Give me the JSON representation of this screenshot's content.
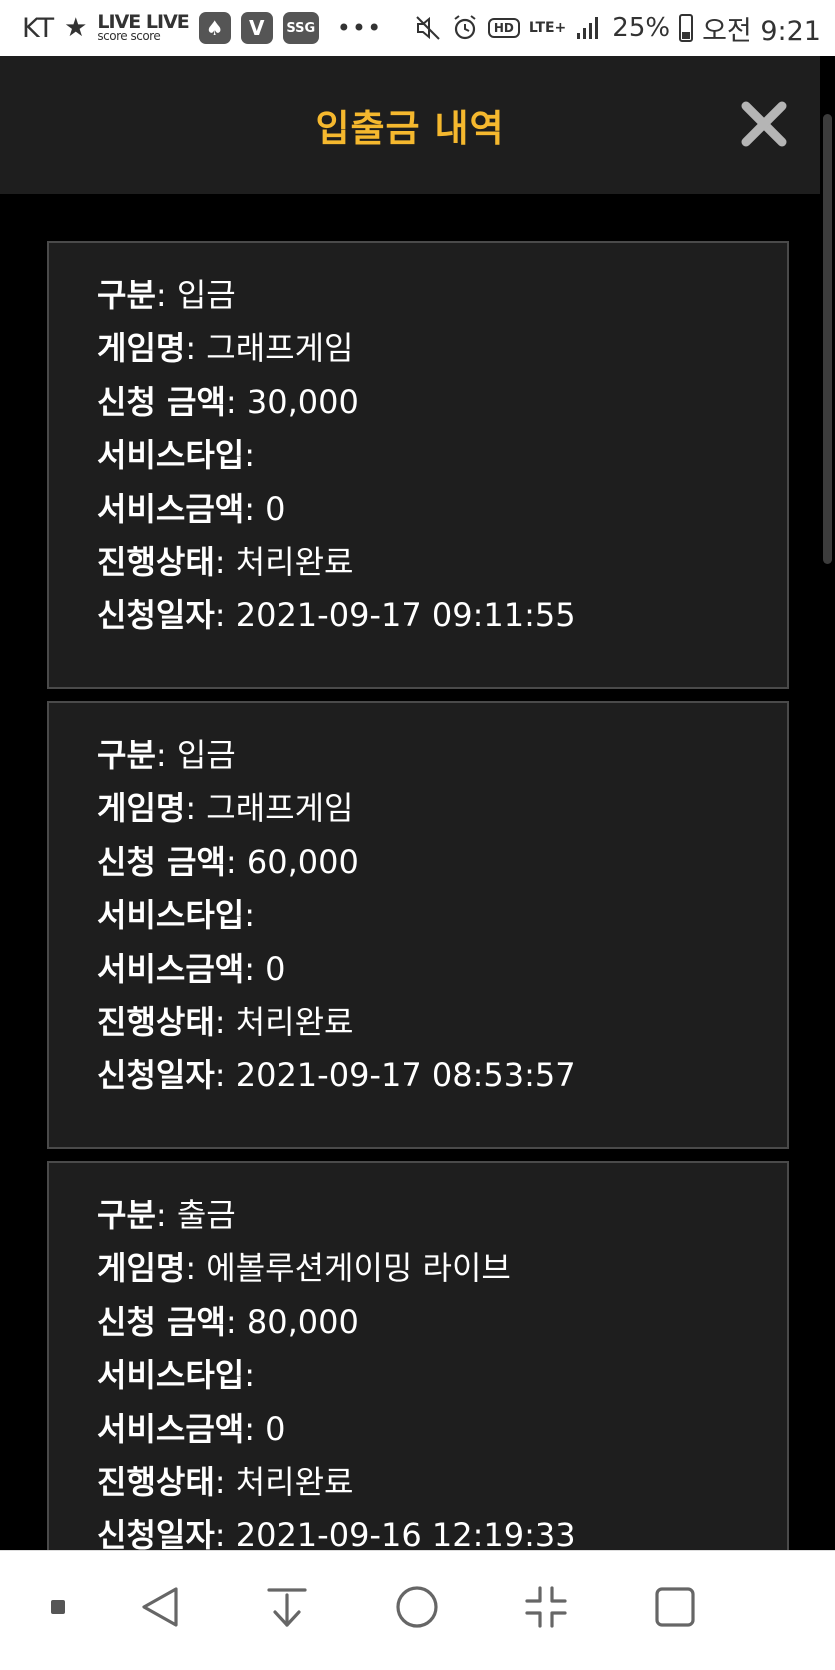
{
  "status_bar": {
    "carrier": "KT",
    "live_top": "LIVE LIVE",
    "live_bottom": "score score",
    "badge_v": "V",
    "badge_ssg": "SSG",
    "more": "•••",
    "hd": "HD",
    "lte": "LTE+",
    "battery": "25%",
    "time": "오전 9:21"
  },
  "header": {
    "title": "입출금 내역"
  },
  "labels": {
    "type": "구분",
    "game": "게임명",
    "amount": "신청 금액",
    "service_type": "서비스타입",
    "service_amount": "서비스금액",
    "status": "진행상태",
    "date": "신청일자"
  },
  "records": [
    {
      "type": "입금",
      "game": "그래프게임",
      "amount": "30,000",
      "service_type": "",
      "service_amount": "0",
      "status": "처리완료",
      "date": "2021-09-17 09:11:55"
    },
    {
      "type": "입금",
      "game": "그래프게임",
      "amount": "60,000",
      "service_type": "",
      "service_amount": "0",
      "status": "처리완료",
      "date": "2021-09-17 08:53:57"
    },
    {
      "type": "출금",
      "game": "에볼루션게이밍 라이브",
      "amount": "80,000",
      "service_type": "",
      "service_amount": "0",
      "status": "처리완료",
      "date": "2021-09-16 12:19:33"
    }
  ],
  "colors": {
    "accent": "#f5b82e",
    "header_bg": "#1e1e1e",
    "card_bg": "#1e1e1e",
    "card_border": "#4a4a4a",
    "page_bg": "#000000"
  }
}
